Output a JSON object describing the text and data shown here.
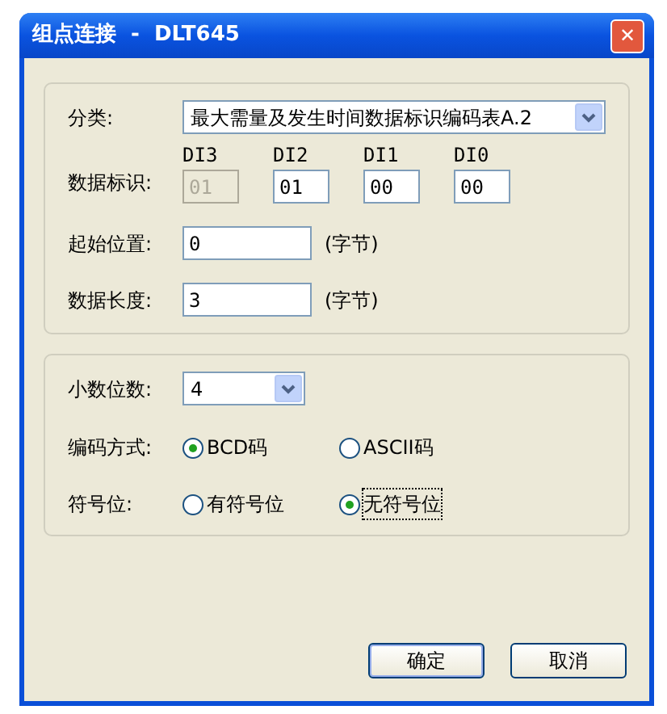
{
  "window": {
    "title": "组点连接  -  DLT645",
    "close": "✕"
  },
  "group1": {
    "category": {
      "label": "分类:",
      "value": "最大需量及发生时间数据标识编码表A.2"
    },
    "data_id": {
      "label": "数据标识:",
      "fields": [
        {
          "heading": "DI3",
          "value": "01",
          "disabled": true
        },
        {
          "heading": "DI2",
          "value": "01",
          "disabled": false
        },
        {
          "heading": "DI1",
          "value": "00",
          "disabled": false
        },
        {
          "heading": "DI0",
          "value": "00",
          "disabled": false
        }
      ]
    },
    "rows": [
      {
        "label": "起始位置:",
        "value": "0",
        "unit": "(字节)"
      },
      {
        "label": "数据长度:",
        "value": "3",
        "unit": "(字节)"
      }
    ]
  },
  "group2": {
    "decimals": {
      "label": "小数位数:",
      "value": "4"
    },
    "radio_groups": [
      {
        "label": "编码方式:",
        "options": [
          {
            "text": "BCD码",
            "selected": true,
            "focused": false
          },
          {
            "text": "ASCII码",
            "selected": false,
            "focused": false
          }
        ]
      },
      {
        "label": "符号位:",
        "options": [
          {
            "text": "有符号位",
            "selected": false,
            "focused": false
          },
          {
            "text": "无符号位",
            "selected": true,
            "focused": true
          }
        ]
      }
    ]
  },
  "buttons": [
    {
      "label": "确定",
      "default": true
    },
    {
      "label": "取消",
      "default": false
    }
  ]
}
